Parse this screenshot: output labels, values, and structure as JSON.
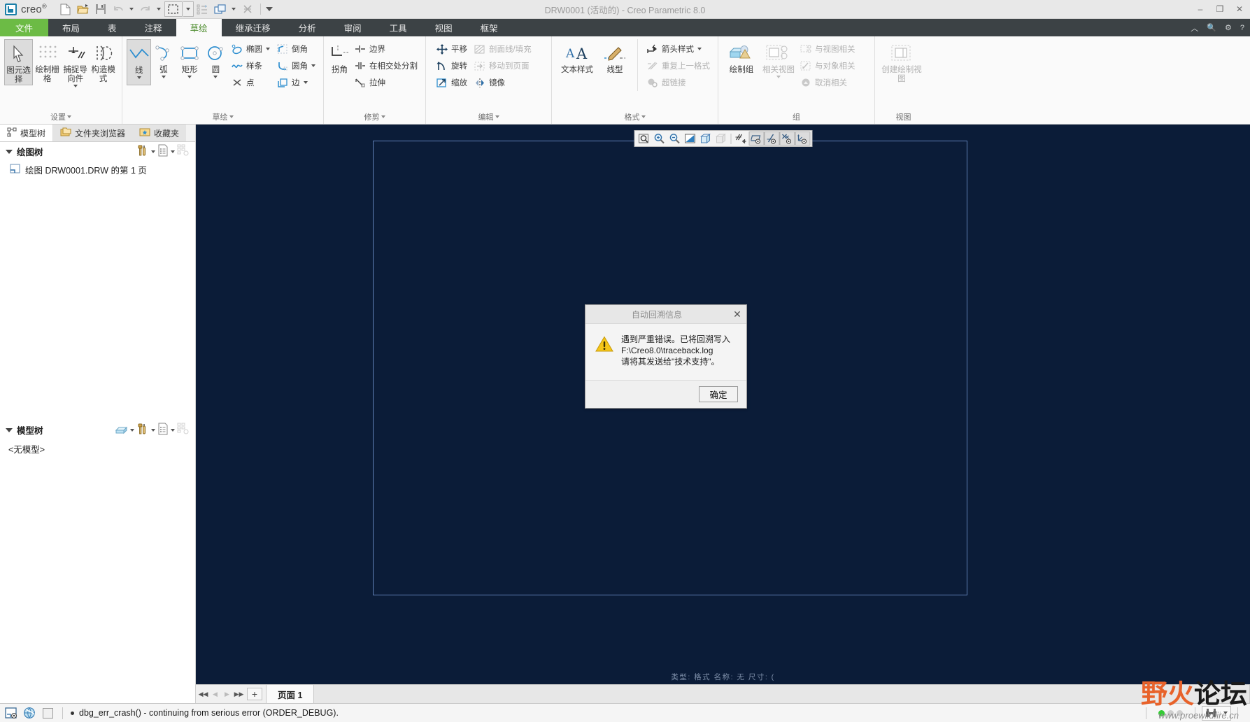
{
  "window": {
    "title": "DRW0001 (活动的) - Creo Parametric 8.0",
    "brand": "creo",
    "brand_sup": "®",
    "minimize": "‒",
    "maximize": "❐",
    "close": "✕"
  },
  "quick_access": {
    "new_label": "新建",
    "open_label": "打开",
    "save_label": "保存",
    "undo_label": "撤消",
    "redo_label": "重做",
    "select_label": "选择",
    "regen_label": "重新生成",
    "window_label": "窗口",
    "close_label": "关闭",
    "more_label": "自定义快速访问工具栏"
  },
  "tabs": [
    {
      "label": "文件",
      "kind": "file"
    },
    {
      "label": "布局",
      "kind": "normal"
    },
    {
      "label": "表",
      "kind": "normal"
    },
    {
      "label": "注释",
      "kind": "normal"
    },
    {
      "label": "草绘",
      "kind": "active"
    },
    {
      "label": "继承迁移",
      "kind": "normal"
    },
    {
      "label": "分析",
      "kind": "normal"
    },
    {
      "label": "审阅",
      "kind": "normal"
    },
    {
      "label": "工具",
      "kind": "normal"
    },
    {
      "label": "视图",
      "kind": "normal"
    },
    {
      "label": "框架",
      "kind": "normal"
    }
  ],
  "tabbar_right": {
    "collapse": "︿",
    "search": "🔍",
    "options": "⚙",
    "help": "?"
  },
  "ribbon": {
    "groups": [
      {
        "label": "设置",
        "has_dialog_launcher": true,
        "big": [
          {
            "label": "图元选择",
            "icon": "cursor-arrow-icon",
            "selected": true,
            "caret": false
          },
          {
            "label": "绘制栅格",
            "icon": "grid-dots-icon",
            "selected": false,
            "caret": false
          },
          {
            "label": "捕捉导向件",
            "icon": "snap-guide-icon",
            "selected": false,
            "caret": true
          },
          {
            "label": "构造模式",
            "icon": "construction-mode-icon",
            "selected": false,
            "caret": false
          }
        ]
      },
      {
        "label": "草绘",
        "has_dialog_launcher": true,
        "big": [
          {
            "label": "线",
            "icon": "line-icon",
            "selected": true,
            "caret": true
          },
          {
            "label": "弧",
            "icon": "arc-icon",
            "selected": false,
            "caret": true
          },
          {
            "label": "矩形",
            "icon": "rectangle-icon",
            "selected": false,
            "caret": true
          },
          {
            "label": "圆",
            "icon": "circle-icon",
            "selected": false,
            "caret": true
          }
        ],
        "small_col_1": [
          {
            "label": "椭圆",
            "icon": "ellipse-icon",
            "caret": true,
            "disabled": false
          },
          {
            "label": "样条",
            "icon": "spline-icon",
            "caret": false,
            "disabled": false
          },
          {
            "label": "点",
            "icon": "point-icon",
            "caret": false,
            "disabled": false
          }
        ],
        "small_col_2": [
          {
            "label": "倒角",
            "icon": "chamfer-icon",
            "caret": false,
            "disabled": false
          },
          {
            "label": "圆角",
            "icon": "fillet-icon",
            "caret": true,
            "disabled": false
          },
          {
            "label": "边",
            "icon": "edge-icon",
            "caret": true,
            "disabled": false
          }
        ]
      },
      {
        "label": "修剪",
        "has_dialog_launcher": true,
        "big": [
          {
            "label": "拐角",
            "icon": "corner-trim-icon",
            "selected": false,
            "caret": false
          }
        ],
        "small_col_1": [
          {
            "label": "边界",
            "icon": "boundary-icon",
            "caret": false,
            "disabled": false
          },
          {
            "label": "在相交处分割",
            "icon": "divide-at-intersection-icon",
            "caret": false,
            "disabled": false
          },
          {
            "label": "拉伸",
            "icon": "stretch-icon",
            "caret": false,
            "disabled": false
          }
        ]
      },
      {
        "label": "编辑",
        "has_dialog_launcher": true,
        "small_col_1": [
          {
            "label": "平移",
            "icon": "translate-icon",
            "caret": false,
            "disabled": false
          },
          {
            "label": "旋转",
            "icon": "rotate-icon",
            "caret": false,
            "disabled": false
          },
          {
            "label": "缩放",
            "icon": "scale-icon",
            "caret": false,
            "disabled": false
          }
        ],
        "small_col_2": [
          {
            "label": "剖面线/填充",
            "icon": "hatch-fill-icon",
            "caret": false,
            "disabled": true
          },
          {
            "label": "移动到页面",
            "icon": "move-to-sheet-icon",
            "caret": false,
            "disabled": true
          },
          {
            "label": "镜像",
            "icon": "mirror-icon",
            "caret": false,
            "disabled": false
          }
        ]
      },
      {
        "label": "格式",
        "has_dialog_launcher": true,
        "big": [
          {
            "label": "文本样式",
            "icon": "text-style-icon",
            "selected": false,
            "caret": false
          },
          {
            "label": "线型",
            "icon": "line-style-icon",
            "selected": false,
            "caret": false
          }
        ],
        "small_col_1": [
          {
            "label": "箭头样式",
            "icon": "arrow-style-icon",
            "caret": true,
            "disabled": false
          },
          {
            "label": "重复上一格式",
            "icon": "repeat-format-icon",
            "caret": false,
            "disabled": true
          },
          {
            "label": "超链接",
            "icon": "hyperlink-icon",
            "caret": false,
            "disabled": true
          }
        ]
      },
      {
        "label": "组",
        "has_dialog_launcher": false,
        "big": [
          {
            "label": "绘制组",
            "icon": "draft-group-icon",
            "selected": false,
            "caret": false
          },
          {
            "label": "相关视图",
            "icon": "related-view-icon",
            "selected": false,
            "caret": true,
            "disabled": true
          }
        ],
        "small_col_1": [
          {
            "label": "与视图相关",
            "icon": "relate-to-view-icon",
            "caret": false,
            "disabled": true
          },
          {
            "label": "与对象相关",
            "icon": "relate-to-object-icon",
            "caret": false,
            "disabled": true
          },
          {
            "label": "取消相关",
            "icon": "unrelate-icon",
            "caret": false,
            "disabled": true
          }
        ]
      },
      {
        "label": "视图",
        "has_dialog_launcher": false,
        "big": [
          {
            "label": "创建绘制视图",
            "icon": "create-draft-view-icon",
            "selected": false,
            "caret": false,
            "disabled": true
          }
        ]
      }
    ]
  },
  "left_dock": {
    "nav_tabs": [
      {
        "label": "模型树",
        "icon": "model-tree-icon",
        "active": true
      },
      {
        "label": "文件夹浏览器",
        "icon": "folder-browser-icon",
        "active": false
      },
      {
        "label": "收藏夹",
        "icon": "favorites-icon",
        "active": false
      }
    ],
    "drawing_tree": {
      "title": "绘图树",
      "item": "绘图 DRW0001.DRW 的第 1 页",
      "item_icon": "drawing-sheet-icon",
      "tools": [
        "settings-hammer-icon",
        "display-list-icon",
        "filter-tree-icon"
      ]
    },
    "model_tree": {
      "title": "模型树",
      "empty_text": "<无模型>",
      "tools": [
        "model-icon",
        "settings-hammer-icon",
        "display-list-icon",
        "filter-tree-icon"
      ]
    }
  },
  "graphics": {
    "background_color": "#0b1c38",
    "sheet_border_color": "#5f7fb5",
    "status_line": "类型: 格式    名称: 无    尺寸: (",
    "toolbar": [
      {
        "name": "zoom-window-icon",
        "active": false
      },
      {
        "name": "zoom-in-icon",
        "active": false
      },
      {
        "name": "zoom-out-icon",
        "active": false
      },
      {
        "name": "refit-icon",
        "active": false
      },
      {
        "name": "display-style-icon",
        "active": false
      },
      {
        "name": "shaded-style-icon",
        "active": false,
        "disabled": true
      },
      {
        "name": "saved-orientations-icon",
        "active": false
      },
      {
        "name": "plane-display-icon",
        "active": true
      },
      {
        "name": "axis-display-icon",
        "active": true
      },
      {
        "name": "point-display-icon",
        "active": true
      },
      {
        "name": "csys-display-icon",
        "active": true
      }
    ]
  },
  "page_bar": {
    "first_label": "◀◀",
    "prev_label": "◀",
    "next_label": "▶",
    "last_label": "▶▶",
    "add_label": "+",
    "active_page": "页面 1"
  },
  "status_bar": {
    "icons": [
      "selection-filter-icon",
      "web-browser-icon",
      "clear-icon"
    ],
    "message": "dbg_err_crash() - continuing from serious error (ORDER_DEBUG).",
    "leds": [
      true,
      false,
      false
    ],
    "search_icon": "binoculars-icon",
    "search_caret": "▾"
  },
  "watermark": {
    "text_1": "野",
    "text_2": "火",
    "text_3": "论坛",
    "url": "www.proewildfire.cn"
  },
  "dialog": {
    "title": "自动回溯信息",
    "close_label": "✕",
    "icon": "warning-triangle-icon",
    "line_1": "遇到严重错误。已将回溯写入",
    "line_2": "F:\\Creo8.0\\traceback.log",
    "line_3": "请将其发送给\"技术支持\"。",
    "ok_label": "确定"
  }
}
